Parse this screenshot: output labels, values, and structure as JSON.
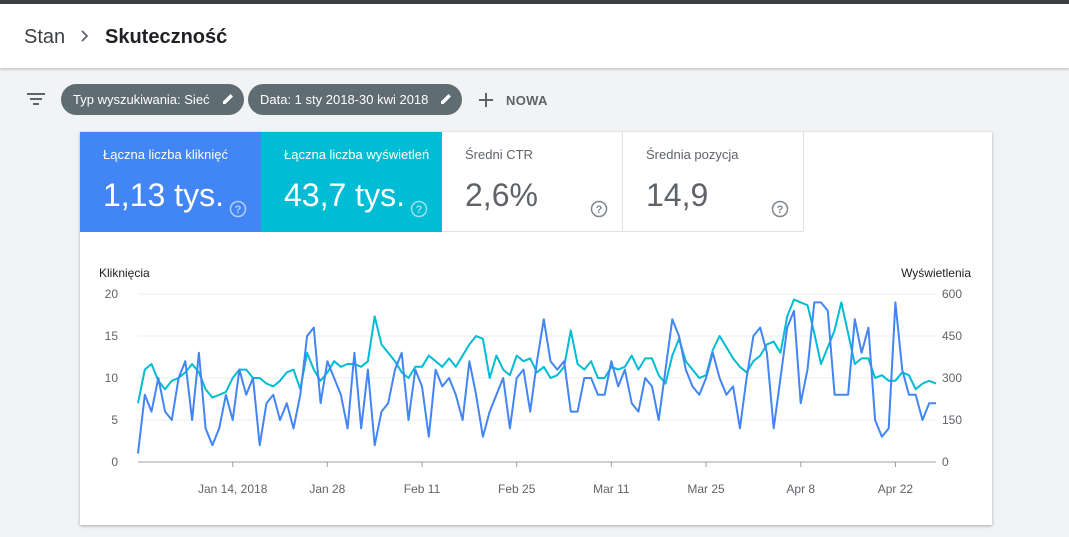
{
  "breadcrumb": {
    "root": "Stan",
    "current": "Skuteczność"
  },
  "filters": {
    "chips": [
      {
        "label": "Typ wyszukiwania: Sieć"
      },
      {
        "label": "Data: 1 sty 2018-30 kwi 2018"
      }
    ],
    "new_label": "NOWA"
  },
  "metrics": [
    {
      "label": "Łączna liczba kliknięć",
      "value": "1,13 tys."
    },
    {
      "label": "Łączna liczba wyświetleń",
      "value": "43,7 tys."
    },
    {
      "label": "Średni CTR",
      "value": "2,6%"
    },
    {
      "label": "Średnia pozycja",
      "value": "14,9"
    }
  ],
  "colors": {
    "clicks": "#4285f4",
    "impressions": "#00bcd4"
  },
  "chart_data": {
    "type": "line",
    "y_left_label": "Kliknięcia",
    "y_right_label": "Wyświetlenia",
    "y_left_ticks": [
      0,
      5,
      10,
      15,
      20
    ],
    "y_right_ticks": [
      0,
      150,
      300,
      450,
      600
    ],
    "ylim_left": [
      0,
      20
    ],
    "ylim_right": [
      0,
      600
    ],
    "x_start": "2018-01-01",
    "x_ticks": [
      {
        "day": 14,
        "label": "Jan 14, 2018"
      },
      {
        "day": 28,
        "label": "Jan 28"
      },
      {
        "day": 42,
        "label": "Feb 11"
      },
      {
        "day": 56,
        "label": "Feb 25"
      },
      {
        "day": 70,
        "label": "Mar 11"
      },
      {
        "day": 84,
        "label": "Mar 25"
      },
      {
        "day": 98,
        "label": "Apr 8"
      },
      {
        "day": 112,
        "label": "Apr 22"
      }
    ],
    "series": [
      {
        "name": "Kliknięcia",
        "axis": "left",
        "values": [
          1,
          8,
          6,
          10,
          6,
          5,
          10,
          12,
          5,
          13,
          4,
          2,
          4,
          8,
          5,
          11,
          8,
          10,
          2,
          7,
          8,
          5,
          7,
          4,
          8,
          15,
          16,
          7,
          12,
          10,
          8,
          4,
          13,
          4,
          11,
          2,
          6,
          7,
          11,
          13,
          5,
          11,
          9,
          3,
          11,
          9,
          10,
          8,
          5,
          12,
          8,
          3,
          6,
          8,
          10,
          4,
          10,
          11,
          6,
          12,
          17,
          12,
          11,
          12,
          6,
          6,
          10,
          10,
          8,
          8,
          12,
          9,
          11,
          7,
          6,
          10,
          9,
          5,
          11,
          17,
          15,
          11,
          9,
          8,
          10,
          13,
          10,
          8,
          9,
          4,
          10,
          15,
          16,
          13,
          4,
          10,
          16,
          18,
          7,
          11,
          19,
          19,
          18,
          8,
          8,
          8,
          17,
          13,
          16,
          5,
          3,
          4,
          19,
          11,
          8,
          8,
          5,
          7,
          7
        ]
      },
      {
        "name": "Wyświetlenia",
        "axis": "right",
        "values": [
          210,
          330,
          350,
          290,
          260,
          290,
          300,
          320,
          350,
          320,
          260,
          230,
          240,
          250,
          300,
          330,
          330,
          300,
          300,
          280,
          270,
          290,
          320,
          330,
          260,
          390,
          330,
          290,
          320,
          360,
          340,
          350,
          350,
          340,
          360,
          520,
          420,
          390,
          360,
          320,
          300,
          340,
          340,
          380,
          360,
          340,
          370,
          340,
          380,
          420,
          450,
          440,
          300,
          380,
          330,
          310,
          380,
          360,
          370,
          320,
          340,
          300,
          310,
          340,
          470,
          350,
          330,
          360,
          300,
          300,
          340,
          330,
          340,
          380,
          330,
          370,
          370,
          310,
          280,
          380,
          440,
          360,
          330,
          300,
          310,
          400,
          450,
          410,
          370,
          340,
          320,
          360,
          380,
          420,
          430,
          390,
          520,
          580,
          570,
          560,
          460,
          350,
          410,
          470,
          570,
          460,
          350,
          370,
          370,
          300,
          310,
          290,
          290,
          320,
          310,
          260,
          280,
          290,
          280
        ]
      }
    ]
  }
}
